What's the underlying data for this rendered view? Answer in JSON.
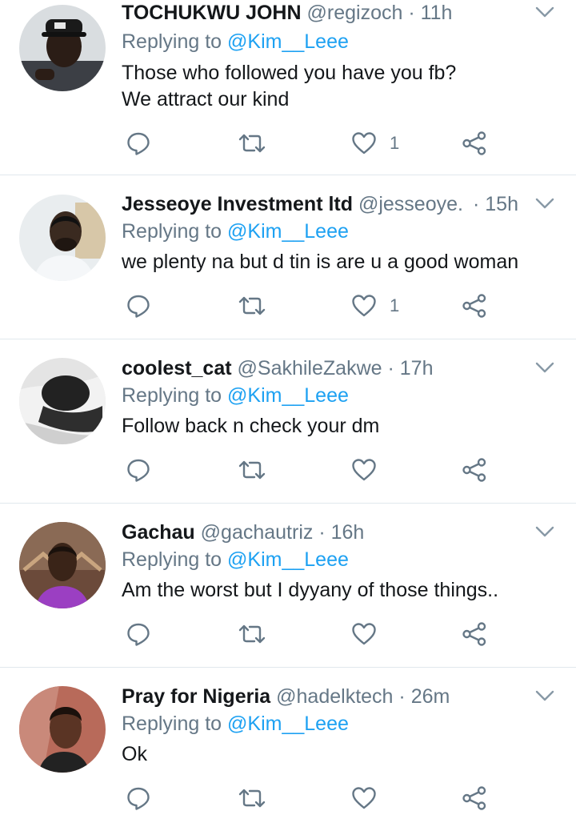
{
  "colors": {
    "text_primary": "#14171a",
    "text_secondary": "#657786",
    "link_blue": "#1da1f2",
    "divider": "#e1e8ed",
    "icon_gray": "#657786"
  },
  "icons": {
    "reply": "reply-bubble-icon",
    "retweet": "retweet-icon",
    "like": "heart-icon",
    "share": "share-icon",
    "menu": "chevron-down-icon"
  },
  "replies": [
    {
      "name": "TOCHUKWU JOHN",
      "handle": "@regizoch",
      "separator": "·",
      "time": "11h",
      "replying_prefix": "Replying to ",
      "replying_to": "@Kim__Leee",
      "lines": [
        "Those who followed you have you fb?",
        "We attract our kind"
      ],
      "like_count": "1"
    },
    {
      "name": "Jesseoye Investment ltd",
      "handle": "@jesseoye...",
      "separator": "·",
      "time": "15h",
      "replying_prefix": "Replying to ",
      "replying_to": "@Kim__Leee",
      "lines": [
        "we plenty na but d tin is are u a good woman"
      ],
      "like_count": "1"
    },
    {
      "name": "coolest_cat",
      "handle": "@SakhileZakwe",
      "separator": "·",
      "time": "17h",
      "replying_prefix": "Replying to ",
      "replying_to": "@Kim__Leee",
      "lines": [
        "Follow back n check your dm"
      ],
      "like_count": ""
    },
    {
      "name": "Gachau",
      "handle": "@gachautriz",
      "separator": "·",
      "time": "16h",
      "replying_prefix": "Replying to ",
      "replying_to": "@Kim__Leee",
      "lines": [
        "Am the worst but I dyyany of those things.."
      ],
      "like_count": ""
    },
    {
      "name": "Pray for Nigeria",
      "handle": "@hadelktech",
      "separator": "·",
      "time": "26m",
      "replying_prefix": "Replying to ",
      "replying_to": "@Kim__Leee",
      "lines": [
        "Ok"
      ],
      "like_count": ""
    }
  ]
}
